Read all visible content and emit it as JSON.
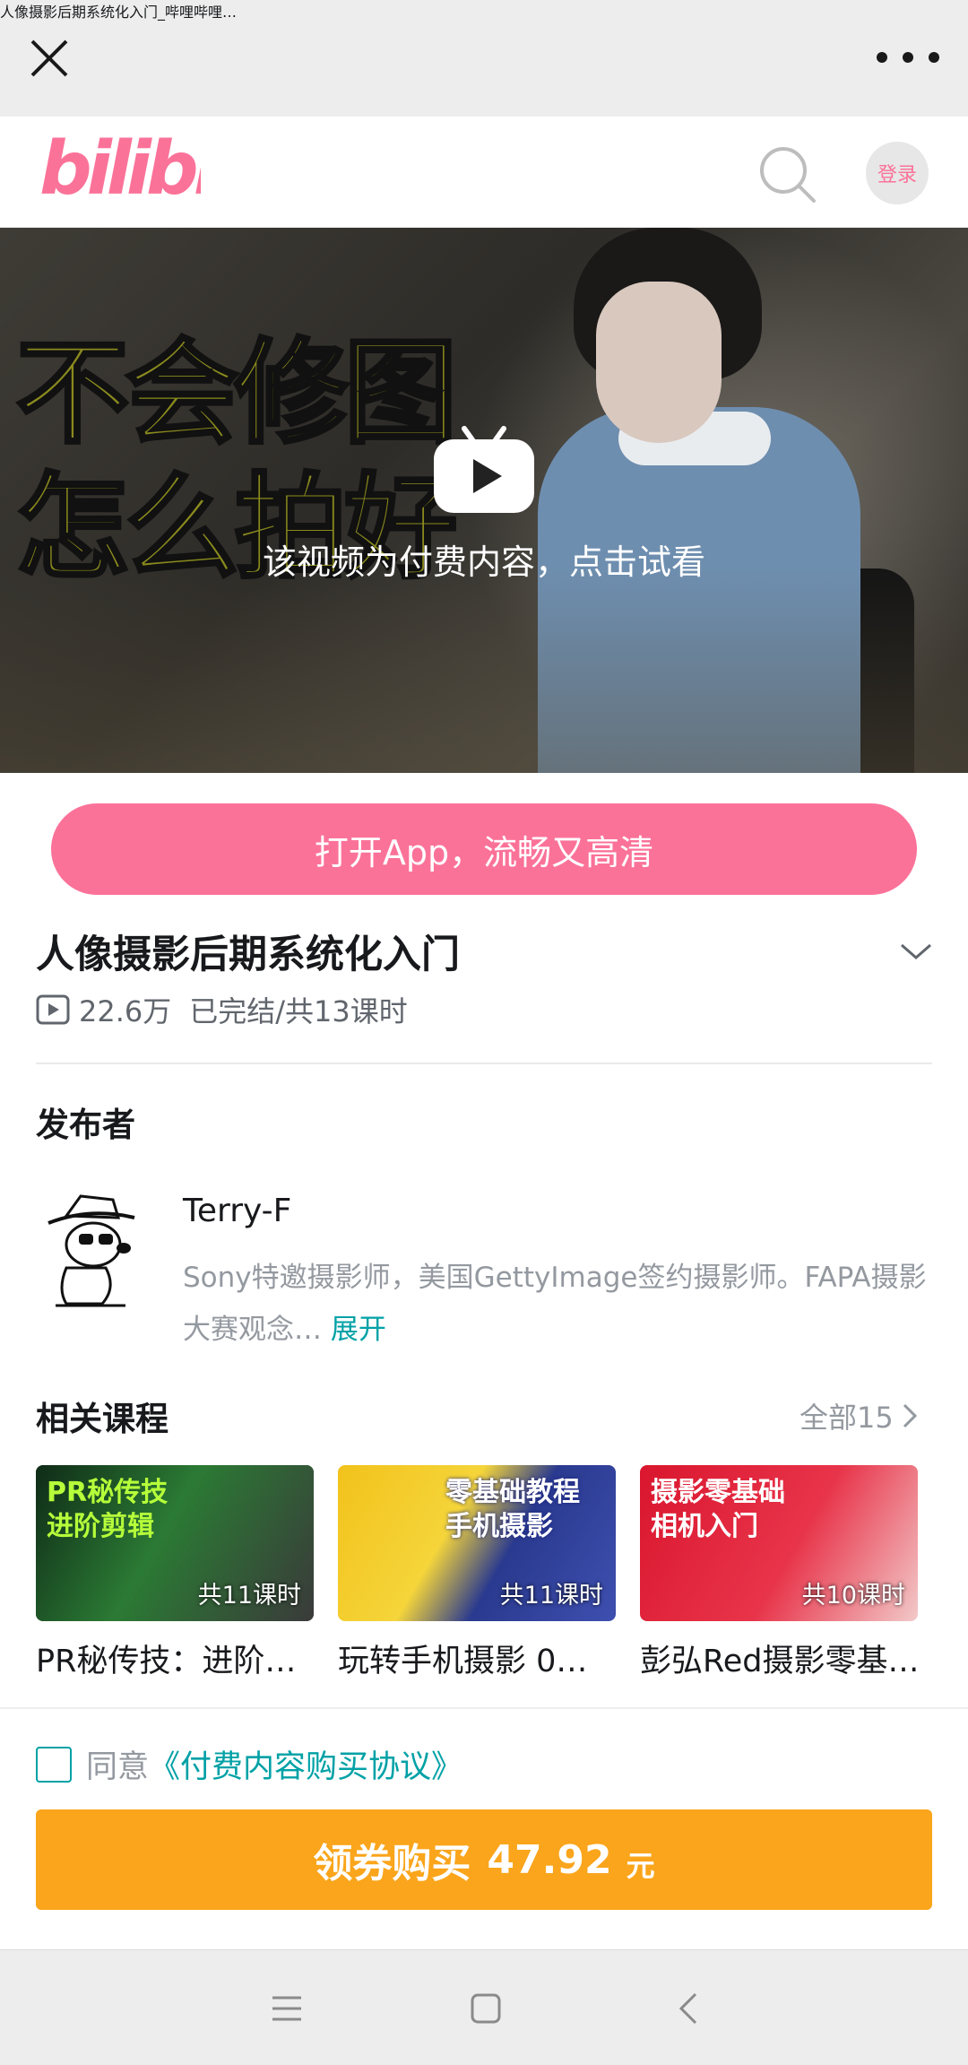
{
  "topbar": {
    "title": "人像摄影后期系统化入门_哔哩哔哩…",
    "close_icon": "close-icon",
    "more_icon": "more-icon"
  },
  "header": {
    "logo_text": "bilibili",
    "login_label": "登录",
    "brand_color": "#fb7299"
  },
  "video": {
    "promo_line1": "不会修图",
    "promo_line2": "怎么拍好",
    "caption": "该视频为付费内容，点击试看"
  },
  "open_app": {
    "label": "打开App，流畅又高清"
  },
  "course": {
    "title": "人像摄影后期系统化入门",
    "views": "22.6万",
    "status": "已完结/共13课时"
  },
  "publisher": {
    "heading": "发布者",
    "name": "Terry-F",
    "desc": "Sony特邀摄影师，美国GettyImage签约摄影师。FAPA摄影大赛观念…",
    "expand": "展开"
  },
  "related": {
    "heading": "相关课程",
    "all_label": "全部15",
    "cards": [
      {
        "thumb_title": "PR秘传技\n进阶剪辑",
        "lessons": "共11课时",
        "label": "PR秘传技：进阶…"
      },
      {
        "thumb_title": "零基础教程\n手机摄影",
        "lessons": "共11课时",
        "label": "玩转手机摄影 0…"
      },
      {
        "thumb_title": "摄影零基础\n相机入门",
        "lessons": "共10课时",
        "label": "彭弘Red摄影零基…"
      }
    ]
  },
  "agreement": {
    "prefix": "同意",
    "link": "《付费内容购买协议》"
  },
  "buy": {
    "label": "领券购买",
    "price": "47.92",
    "unit": "元",
    "color": "#faa51b"
  }
}
